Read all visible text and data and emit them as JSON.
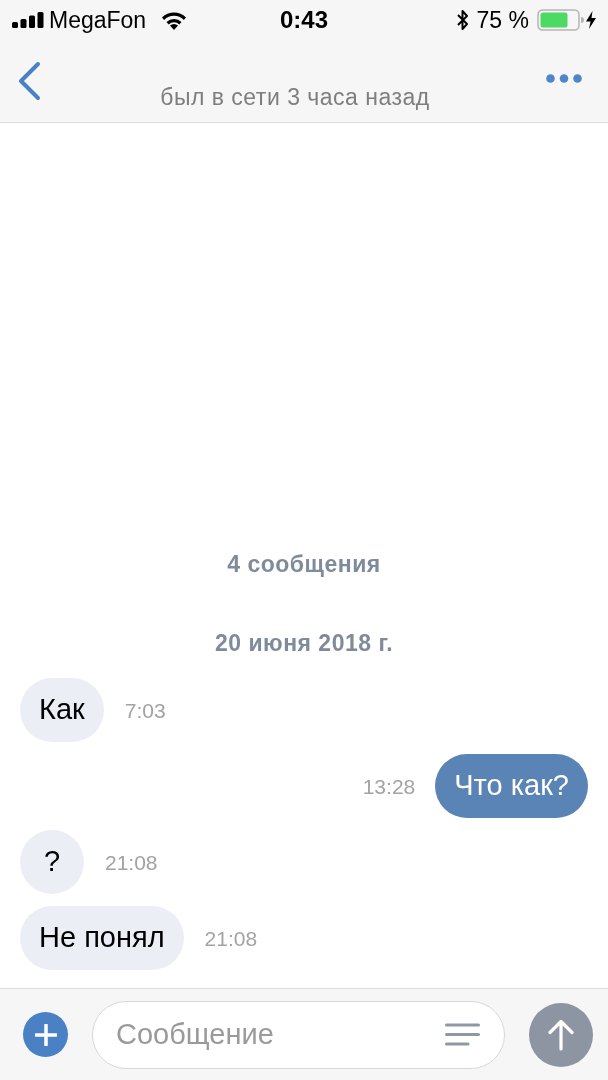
{
  "status_bar": {
    "carrier": "MegaFon",
    "time": "0:43",
    "battery_text": "75 %"
  },
  "header": {
    "status": "был в сети 3 часа назад"
  },
  "conversation": {
    "count": "4 сообщения",
    "date": "20 июня 2018 г.",
    "messages": [
      {
        "kind": "incoming",
        "text": "Как",
        "time": "7:03"
      },
      {
        "kind": "outgoing",
        "text": "Что как?",
        "time": "13:28"
      },
      {
        "kind": "incoming",
        "text": "?",
        "time": "21:08"
      },
      {
        "kind": "incoming",
        "text": "Не понял",
        "time": "21:08"
      }
    ]
  },
  "composer": {
    "placeholder": "Сообщение"
  }
}
